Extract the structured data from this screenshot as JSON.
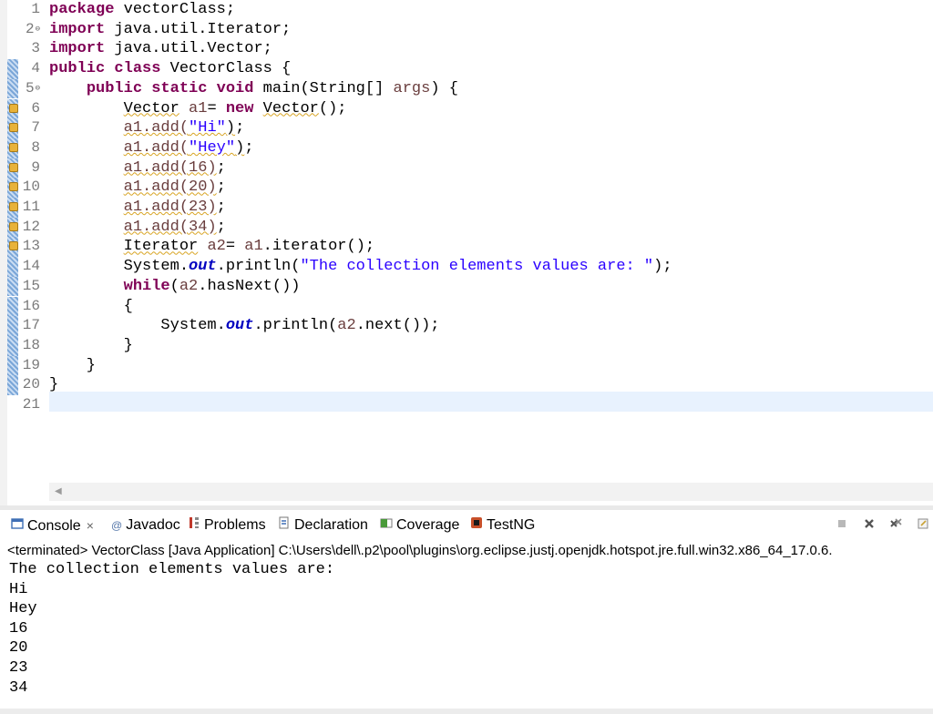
{
  "editor": {
    "lines": [
      {
        "n": "1",
        "fold": "",
        "mark": false,
        "warn": false,
        "tokens": [
          {
            "t": "kw",
            "v": "package"
          },
          {
            "t": "",
            "v": " vectorClass;"
          }
        ]
      },
      {
        "n": "2",
        "fold": "⊖",
        "mark": false,
        "warn": false,
        "tokens": [
          {
            "t": "kw",
            "v": "import"
          },
          {
            "t": "",
            "v": " java.util.Iterator;"
          }
        ]
      },
      {
        "n": "3",
        "fold": "",
        "mark": false,
        "warn": false,
        "tokens": [
          {
            "t": "kw",
            "v": "import"
          },
          {
            "t": "",
            "v": " java.util.Vector;"
          }
        ]
      },
      {
        "n": "4",
        "fold": "",
        "mark": true,
        "warn": false,
        "tokens": [
          {
            "t": "kw",
            "v": "public"
          },
          {
            "t": "",
            "v": " "
          },
          {
            "t": "kw",
            "v": "class"
          },
          {
            "t": "",
            "v": " VectorClass {"
          }
        ]
      },
      {
        "n": "5",
        "fold": "⊖",
        "mark": true,
        "warn": false,
        "tokens": [
          {
            "t": "",
            "v": "    "
          },
          {
            "t": "kw",
            "v": "public"
          },
          {
            "t": "",
            "v": " "
          },
          {
            "t": "kw",
            "v": "static"
          },
          {
            "t": "",
            "v": " "
          },
          {
            "t": "kw",
            "v": "void"
          },
          {
            "t": "",
            "v": " main(String[] "
          },
          {
            "t": "var",
            "v": "args"
          },
          {
            "t": "",
            "v": ") {"
          }
        ]
      },
      {
        "n": "6",
        "fold": "",
        "mark": true,
        "warn": true,
        "tokens": [
          {
            "t": "",
            "v": "        "
          },
          {
            "t": "sq",
            "v": "Vector"
          },
          {
            "t": "",
            "v": " "
          },
          {
            "t": "var",
            "v": "a1"
          },
          {
            "t": "",
            "v": "= "
          },
          {
            "t": "kw",
            "v": "new"
          },
          {
            "t": "",
            "v": " "
          },
          {
            "t": "sq",
            "v": "Vector"
          },
          {
            "t": "",
            "v": "();"
          }
        ]
      },
      {
        "n": "7",
        "fold": "",
        "mark": true,
        "warn": true,
        "tokens": [
          {
            "t": "",
            "v": "        "
          },
          {
            "t": "sqv",
            "v": "a1.add("
          },
          {
            "t": "sqs",
            "v": "\"Hi\""
          },
          {
            "t": "sq",
            "v": ")"
          },
          {
            "t": "",
            "v": ";"
          }
        ]
      },
      {
        "n": "8",
        "fold": "",
        "mark": true,
        "warn": true,
        "tokens": [
          {
            "t": "",
            "v": "        "
          },
          {
            "t": "sqv",
            "v": "a1.add("
          },
          {
            "t": "sqs",
            "v": "\"Hey\""
          },
          {
            "t": "sq",
            "v": ")"
          },
          {
            "t": "",
            "v": ";"
          }
        ]
      },
      {
        "n": "9",
        "fold": "",
        "mark": true,
        "warn": true,
        "tokens": [
          {
            "t": "",
            "v": "        "
          },
          {
            "t": "sqv",
            "v": "a1.add(16)"
          },
          {
            "t": "",
            "v": ";"
          }
        ]
      },
      {
        "n": "10",
        "fold": "",
        "mark": true,
        "warn": true,
        "tokens": [
          {
            "t": "",
            "v": "        "
          },
          {
            "t": "sqv",
            "v": "a1.add(20)"
          },
          {
            "t": "",
            "v": ";"
          }
        ]
      },
      {
        "n": "11",
        "fold": "",
        "mark": true,
        "warn": true,
        "tokens": [
          {
            "t": "",
            "v": "        "
          },
          {
            "t": "sqv",
            "v": "a1.add(23)"
          },
          {
            "t": "",
            "v": ";"
          }
        ]
      },
      {
        "n": "12",
        "fold": "",
        "mark": true,
        "warn": true,
        "tokens": [
          {
            "t": "",
            "v": "        "
          },
          {
            "t": "sqv",
            "v": "a1.add(34)"
          },
          {
            "t": "",
            "v": ";"
          }
        ]
      },
      {
        "n": "13",
        "fold": "",
        "mark": true,
        "warn": true,
        "tokens": [
          {
            "t": "",
            "v": "        "
          },
          {
            "t": "sq",
            "v": "Iterator"
          },
          {
            "t": "",
            "v": " "
          },
          {
            "t": "var",
            "v": "a2"
          },
          {
            "t": "",
            "v": "= "
          },
          {
            "t": "var",
            "v": "a1"
          },
          {
            "t": "",
            "v": ".iterator();"
          }
        ]
      },
      {
        "n": "14",
        "fold": "",
        "mark": true,
        "warn": false,
        "tokens": [
          {
            "t": "",
            "v": "        System."
          },
          {
            "t": "fld",
            "v": "out"
          },
          {
            "t": "",
            "v": ".println("
          },
          {
            "t": "str",
            "v": "\"The collection elements values are: \""
          },
          {
            "t": "",
            "v": ");"
          }
        ]
      },
      {
        "n": "15",
        "fold": "",
        "mark": true,
        "warn": false,
        "tokens": [
          {
            "t": "",
            "v": "        "
          },
          {
            "t": "kw",
            "v": "while"
          },
          {
            "t": "",
            "v": "("
          },
          {
            "t": "var",
            "v": "a2"
          },
          {
            "t": "",
            "v": ".hasNext())"
          }
        ]
      },
      {
        "n": "16",
        "fold": "",
        "mark": true,
        "warn": false,
        "tokens": [
          {
            "t": "",
            "v": "        {"
          }
        ]
      },
      {
        "n": "17",
        "fold": "",
        "mark": true,
        "warn": false,
        "tokens": [
          {
            "t": "",
            "v": "            System."
          },
          {
            "t": "fld",
            "v": "out"
          },
          {
            "t": "",
            "v": ".println("
          },
          {
            "t": "var",
            "v": "a2"
          },
          {
            "t": "",
            "v": ".next());"
          }
        ]
      },
      {
        "n": "18",
        "fold": "",
        "mark": true,
        "warn": false,
        "tokens": [
          {
            "t": "",
            "v": "        }"
          }
        ]
      },
      {
        "n": "19",
        "fold": "",
        "mark": true,
        "warn": false,
        "tokens": [
          {
            "t": "",
            "v": "    }"
          }
        ]
      },
      {
        "n": "20",
        "fold": "",
        "mark": true,
        "warn": false,
        "tokens": [
          {
            "t": "",
            "v": "}"
          }
        ]
      },
      {
        "n": "21",
        "fold": "",
        "mark": false,
        "warn": false,
        "tokens": []
      }
    ]
  },
  "console_view": {
    "tabs": [
      {
        "id": "console",
        "label": "Console",
        "close": "×",
        "icon": "console-icon",
        "icon_color": "#3f6fb5"
      },
      {
        "id": "javadoc",
        "label": "Javadoc",
        "close": "",
        "icon": "at-sign-icon",
        "icon_glyph": "@",
        "icon_color": "#5577aa"
      },
      {
        "id": "problems",
        "label": "Problems",
        "close": "",
        "icon": "problems-icon",
        "icon_color": "#c0392b"
      },
      {
        "id": "declaration",
        "label": "Declaration",
        "close": "",
        "icon": "declaration-icon",
        "icon_color": "#3f6fb5"
      },
      {
        "id": "coverage",
        "label": "Coverage",
        "close": "",
        "icon": "coverage-icon",
        "icon_color": "#4a9a3a"
      },
      {
        "id": "testng",
        "label": "TestNG",
        "close": "",
        "icon": "testng-icon",
        "icon_color": "#c8502a"
      }
    ],
    "status": "<terminated> VectorClass [Java Application] C:\\Users\\dell\\.p2\\pool\\plugins\\org.eclipse.justj.openjdk.hotspot.jre.full.win32.x86_64_17.0.6.",
    "output": [
      "The collection elements values are: ",
      "Hi",
      "Hey",
      "16",
      "20",
      "23",
      "34"
    ]
  },
  "colors": {
    "keyword": "#7f0055",
    "string": "#2a00ff",
    "field": "#0000c0",
    "local_var": "#6a3e3e",
    "current_line": "#e8f2fe"
  }
}
